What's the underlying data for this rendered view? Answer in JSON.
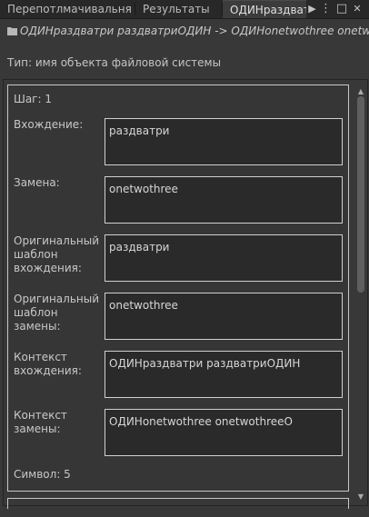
{
  "tabs": [
    {
      "label": "Перепотлмачивальня"
    },
    {
      "label": "Результаты"
    },
    {
      "label": "ОДИНраздватри",
      "active": true
    }
  ],
  "toolbar_icons": [
    "play-icon",
    "more-vert-icon",
    "maximize-icon",
    "close-icon"
  ],
  "toolbar_glyphs": {
    "play": "▶",
    "more": "⋮",
    "maximize": "□",
    "close": "✕"
  },
  "breadcrumb": {
    "icon": "folder-icon",
    "text": "ОДИНраздватри раздватриОДИН -> ОДИНonetwothree onetwothreeОДИН"
  },
  "type_line": "Тип: имя объекта файловой системы",
  "step": "Шаг: 1",
  "fields": [
    {
      "label": "Вхождение:",
      "value": "раздватри"
    },
    {
      "label": "Замена:",
      "value": "onetwothree"
    },
    {
      "label": "Оригинальный шаблон вхождения:",
      "value": "раздватри"
    },
    {
      "label": "Оригинальный шаблон замены:",
      "value": "onetwothree"
    },
    {
      "label": "Контекст вхождения:",
      "value": "ОДИНраздватри раздватриОДИН"
    },
    {
      "label": "Контекст замены:",
      "value": "ОДИНonetwothree onetwothreeО"
    }
  ],
  "symbol": "Символ: 5",
  "scrollbar": {
    "up": "▲",
    "down": "▼",
    "thumb_fraction": 0.47
  },
  "colors": {
    "background": "#383838",
    "tabbar": "#282828",
    "field_bg": "#2a2a2a",
    "border": "#c8c8c8"
  }
}
